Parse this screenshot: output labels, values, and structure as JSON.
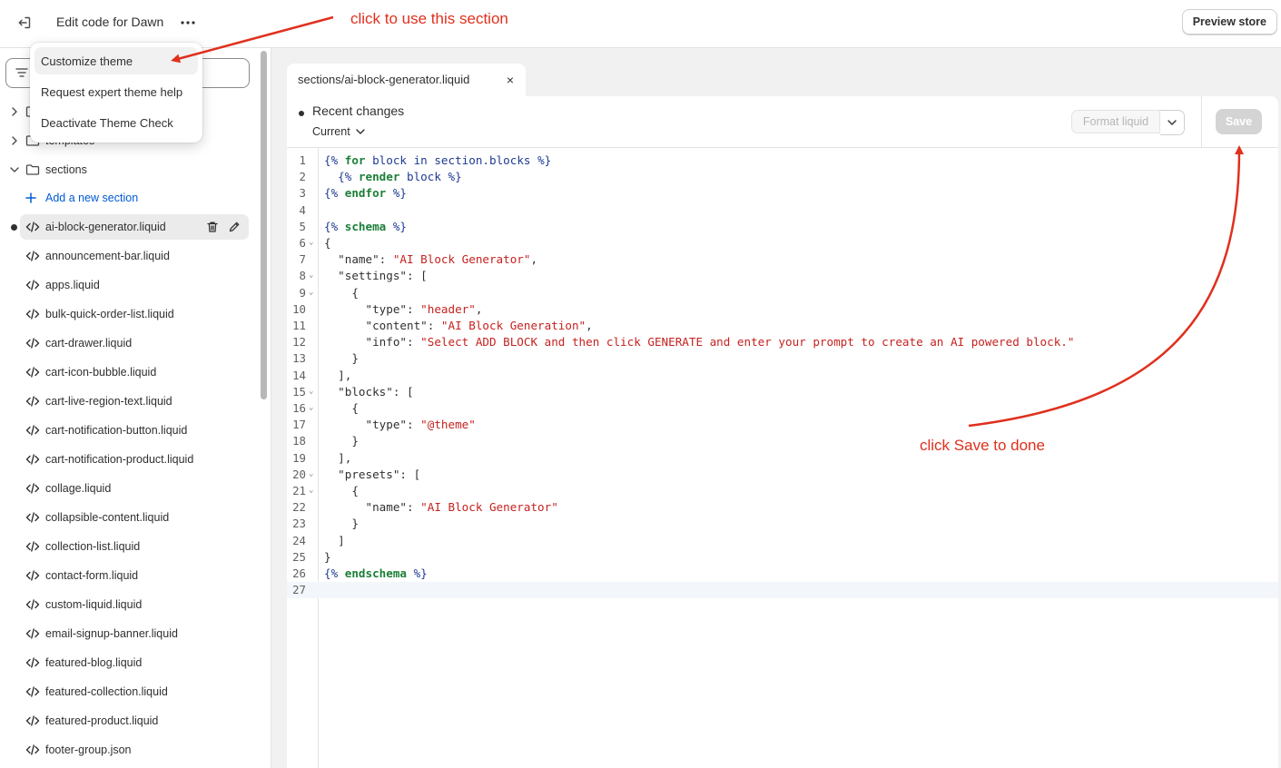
{
  "header": {
    "title": "Edit code for Dawn",
    "preview_label": "Preview store"
  },
  "menu": {
    "items": [
      {
        "label": "Customize theme"
      },
      {
        "label": "Request expert theme help"
      },
      {
        "label": "Deactivate Theme Check"
      }
    ]
  },
  "sidebar": {
    "folders": [
      {
        "label": "",
        "expanded": false
      },
      {
        "label": "templates",
        "expanded": false
      },
      {
        "label": "sections",
        "expanded": true
      }
    ],
    "add_section_label": "Add a new section",
    "files": [
      {
        "label": "ai-block-generator.liquid",
        "active": true,
        "modified": true
      },
      {
        "label": "announcement-bar.liquid"
      },
      {
        "label": "apps.liquid"
      },
      {
        "label": "bulk-quick-order-list.liquid"
      },
      {
        "label": "cart-drawer.liquid"
      },
      {
        "label": "cart-icon-bubble.liquid"
      },
      {
        "label": "cart-live-region-text.liquid"
      },
      {
        "label": "cart-notification-button.liquid"
      },
      {
        "label": "cart-notification-product.liquid"
      },
      {
        "label": "collage.liquid"
      },
      {
        "label": "collapsible-content.liquid"
      },
      {
        "label": "collection-list.liquid"
      },
      {
        "label": "contact-form.liquid"
      },
      {
        "label": "custom-liquid.liquid"
      },
      {
        "label": "email-signup-banner.liquid"
      },
      {
        "label": "featured-blog.liquid"
      },
      {
        "label": "featured-collection.liquid"
      },
      {
        "label": "featured-product.liquid"
      },
      {
        "label": "footer-group.json"
      }
    ]
  },
  "editor": {
    "tab": {
      "dir": "sections/",
      "file": "ai-block-generator.liquid",
      "close": "×"
    },
    "recent_changes": "Recent changes",
    "version_select": "Current",
    "format_label": "Format liquid",
    "save_label": "Save",
    "lines": [
      [
        [
          "tag",
          "{% "
        ],
        [
          "kw",
          "for"
        ],
        [
          "var",
          " block "
        ],
        [
          "tag",
          "in"
        ],
        [
          "var",
          " section.blocks "
        ],
        [
          "tag",
          "%}"
        ]
      ],
      [
        [
          "tag",
          "  {% "
        ],
        [
          "kw",
          "render"
        ],
        [
          "var",
          " block "
        ],
        [
          "tag",
          "%}"
        ]
      ],
      [
        [
          "tag",
          "{% "
        ],
        [
          "kw",
          "endfor"
        ],
        [
          "tag",
          " %}"
        ]
      ],
      [],
      [
        [
          "tag",
          "{% "
        ],
        [
          "kw",
          "schema"
        ],
        [
          "tag",
          " %}"
        ]
      ],
      [
        [
          "p",
          "{"
        ]
      ],
      [
        [
          "p",
          "  \"name\": "
        ],
        [
          "str",
          "\"AI Block Generator\""
        ],
        [
          "p",
          ","
        ]
      ],
      [
        [
          "p",
          "  \"settings\": ["
        ]
      ],
      [
        [
          "p",
          "    {"
        ]
      ],
      [
        [
          "p",
          "      \"type\": "
        ],
        [
          "str",
          "\"header\""
        ],
        [
          "p",
          ","
        ]
      ],
      [
        [
          "p",
          "      \"content\": "
        ],
        [
          "str",
          "\"AI Block Generation\""
        ],
        [
          "p",
          ","
        ]
      ],
      [
        [
          "p",
          "      \"info\": "
        ],
        [
          "str",
          "\"Select ADD BLOCK and then click GENERATE and enter your prompt to create an AI powered block.\""
        ]
      ],
      [
        [
          "p",
          "    }"
        ]
      ],
      [
        [
          "p",
          "  ],"
        ]
      ],
      [
        [
          "p",
          "  \"blocks\": ["
        ]
      ],
      [
        [
          "p",
          "    {"
        ]
      ],
      [
        [
          "p",
          "      \"type\": "
        ],
        [
          "str",
          "\"@theme\""
        ]
      ],
      [
        [
          "p",
          "    }"
        ]
      ],
      [
        [
          "p",
          "  ],"
        ]
      ],
      [
        [
          "p",
          "  \"presets\": ["
        ]
      ],
      [
        [
          "p",
          "    {"
        ]
      ],
      [
        [
          "p",
          "      \"name\": "
        ],
        [
          "str",
          "\"AI Block Generator\""
        ]
      ],
      [
        [
          "p",
          "    }"
        ]
      ],
      [
        [
          "p",
          "  ]"
        ]
      ],
      [
        [
          "p",
          "}"
        ]
      ],
      [
        [
          "tag",
          "{% "
        ],
        [
          "kw",
          "endschema"
        ],
        [
          "tag",
          " %}"
        ]
      ],
      []
    ],
    "fold_lines": [
      6,
      8,
      9,
      15,
      16,
      20,
      21
    ],
    "current_line": 27
  },
  "annotations": {
    "top": "click to use this section",
    "right": "click Save to done",
    "color": "#e0301e"
  }
}
